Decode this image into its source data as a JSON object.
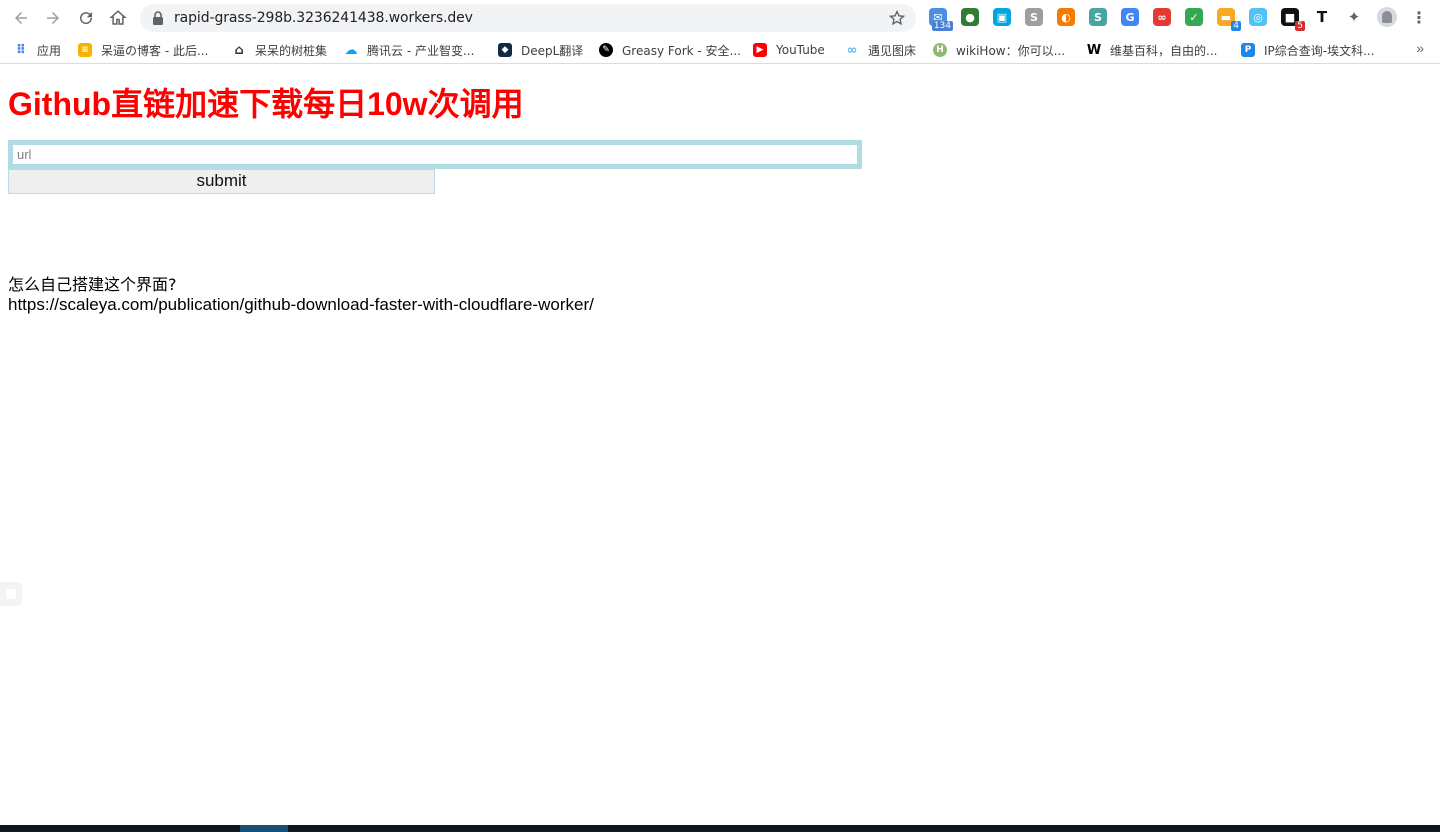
{
  "browser": {
    "address_bar": {
      "url": "rapid-grass-298b.3236241438.workers.dev"
    },
    "extensions": [
      {
        "name": "gmail-cat-extension-icon",
        "color": "#4a90e2",
        "badge": "134",
        "badge_color": "#4a7fd4"
      },
      {
        "name": "globe-extension-icon",
        "color": "#2e7d32",
        "badge": "",
        "badge_color": ""
      },
      {
        "name": "screen-capture-extension-icon",
        "color": "#00a6e2",
        "badge": "",
        "badge_color": ""
      },
      {
        "name": "s-gray-extension-icon",
        "color": "#9e9e9e",
        "badge": "",
        "badge_color": ""
      },
      {
        "name": "firefox-extension-icon",
        "color": "#f57c00",
        "badge": "",
        "badge_color": ""
      },
      {
        "name": "s-teal-extension-icon",
        "color": "#45a6a3",
        "badge": "",
        "badge_color": ""
      },
      {
        "name": "google-translate-extension-icon",
        "color": "#4285f4",
        "badge": "",
        "badge_color": ""
      },
      {
        "name": "infinity-extension-icon",
        "color": "#e53935",
        "badge": "",
        "badge_color": ""
      },
      {
        "name": "shield-extension-icon",
        "color": "#34a853",
        "badge": "",
        "badge_color": ""
      },
      {
        "name": "ticket-extension-icon",
        "color": "#f9a825",
        "badge": "4",
        "badge_color": "#1e88e5"
      },
      {
        "name": "search-bubble-extension-icon",
        "color": "#4fc3f7",
        "badge": "",
        "badge_color": ""
      },
      {
        "name": "black-box-extension-icon",
        "color": "#111111",
        "badge": "5",
        "badge_color": "#d32f2f"
      },
      {
        "name": "t-extension-icon",
        "color": "#ffffff",
        "badge": "",
        "badge_color": ""
      },
      {
        "name": "puzzle-extensions-icon",
        "color": "#5f6368",
        "badge": "",
        "badge_color": ""
      }
    ],
    "bookmarks": [
      {
        "name": "bookmark-apps",
        "label": "应用",
        "icon": "apps-grid-icon",
        "color": "#4285f4"
      },
      {
        "name": "bookmark-blog",
        "label": "呆逼の博客 - 此后...",
        "icon": "stack-icon",
        "color": "#f4b400"
      },
      {
        "name": "bookmark-daidai",
        "label": "呆呆的树桩集",
        "icon": "home-icon",
        "color": "#333333"
      },
      {
        "name": "bookmark-tencent-cloud",
        "label": "腾讯云 - 产业智变...",
        "icon": "cloud-icon",
        "color": "#00a3ff"
      },
      {
        "name": "bookmark-deepl",
        "label": "DeepL翻译",
        "icon": "deepl-icon",
        "color": "#0f2b46"
      },
      {
        "name": "bookmark-greasy-fork",
        "label": "Greasy Fork - 安全...",
        "icon": "greasy-fork-icon",
        "color": "#000000"
      },
      {
        "name": "bookmark-youtube",
        "label": "YouTube",
        "icon": "youtube-icon",
        "color": "#ff0000"
      },
      {
        "name": "bookmark-image-host",
        "label": "遇见图床",
        "icon": "infinity-icon",
        "color": "#5bb8f0"
      },
      {
        "name": "bookmark-wikihow",
        "label": "wikiHow：你可以...",
        "icon": "wikihow-icon",
        "color": "#93b874"
      },
      {
        "name": "bookmark-wikipedia",
        "label": "维基百科，自由的...",
        "icon": "wikipedia-icon",
        "color": "#000000"
      },
      {
        "name": "bookmark-ip-query",
        "label": "IP综合查询-埃文科...",
        "icon": "ip-icon",
        "color": "#1e88e5"
      }
    ],
    "bookmarks_overflow": "»"
  },
  "page": {
    "title": "Github直链加速下载每日10w次调用",
    "url_input": {
      "placeholder": "url",
      "value": ""
    },
    "submit_label": "submit",
    "help_question": "怎么自己搭建这个界面?",
    "help_link": "https://scaleya.com/publication/github-download-faster-with-cloudflare-worker/"
  }
}
